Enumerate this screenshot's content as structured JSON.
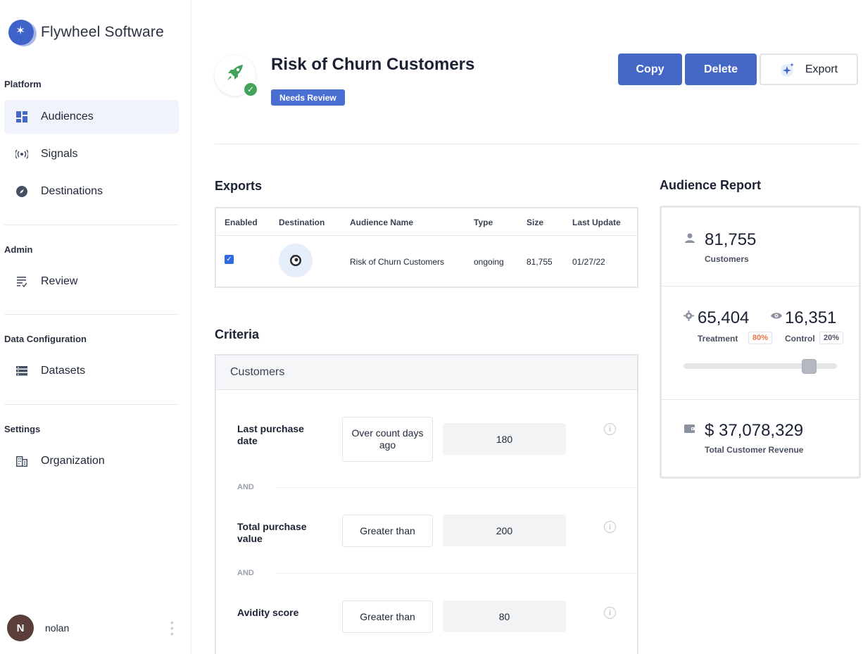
{
  "brand": {
    "name": "Flywheel Software"
  },
  "sidebar": {
    "sections": [
      {
        "title": "Platform"
      },
      {
        "title": "Admin"
      },
      {
        "title": "Data Configuration"
      },
      {
        "title": "Settings"
      }
    ],
    "items": [
      {
        "label": "Audiences",
        "icon": "dashboard-icon",
        "active": true
      },
      {
        "label": "Signals",
        "icon": "signal-icon"
      },
      {
        "label": "Destinations",
        "icon": "compass-icon"
      },
      {
        "label": "Review",
        "icon": "review-list-icon"
      },
      {
        "label": "Datasets",
        "icon": "datasets-icon"
      },
      {
        "label": "Organization",
        "icon": "building-icon"
      }
    ]
  },
  "user": {
    "initial": "N",
    "name": "nolan"
  },
  "header": {
    "title": "Risk of Churn Customers",
    "badge": "Needs Review",
    "copy_label": "Copy",
    "delete_label": "Delete",
    "export_label": "Export"
  },
  "exports": {
    "title": "Exports",
    "columns": [
      "Enabled",
      "Destination",
      "Audience Name",
      "Type",
      "Size",
      "Last Update"
    ],
    "rows": [
      {
        "enabled": true,
        "destination_icon": "mailchimp-icon",
        "audience_name": "Risk of Churn Customers",
        "type": "ongoing",
        "size": "81,755",
        "last_update": "01/27/22"
      }
    ]
  },
  "criteria": {
    "title": "Criteria",
    "group": "Customers",
    "and_label": "AND",
    "rules": [
      {
        "field": "Last purchase date",
        "operator": "Over count days ago",
        "value": "180"
      },
      {
        "field": "Total purchase value",
        "operator": "Greater than",
        "value": "200"
      },
      {
        "field": "Avidity score",
        "operator": "Greater than",
        "value": "80"
      }
    ]
  },
  "report": {
    "title": "Audience Report",
    "customers": {
      "value": "81,755",
      "label": "Customers"
    },
    "treatment": {
      "value": "65,404",
      "label": "Treatment",
      "pct": "80%"
    },
    "control": {
      "value": "16,351",
      "label": "Control",
      "pct": "20%"
    },
    "split_treatment_fraction": 0.8,
    "revenue": {
      "value": "$ 37,078,329",
      "label": "Total Customer Revenue"
    }
  },
  "colors": {
    "primary": "#4568c7",
    "badge": "#4a6fd3",
    "success": "#43a35b",
    "treatment_pct": "#e8734a"
  }
}
